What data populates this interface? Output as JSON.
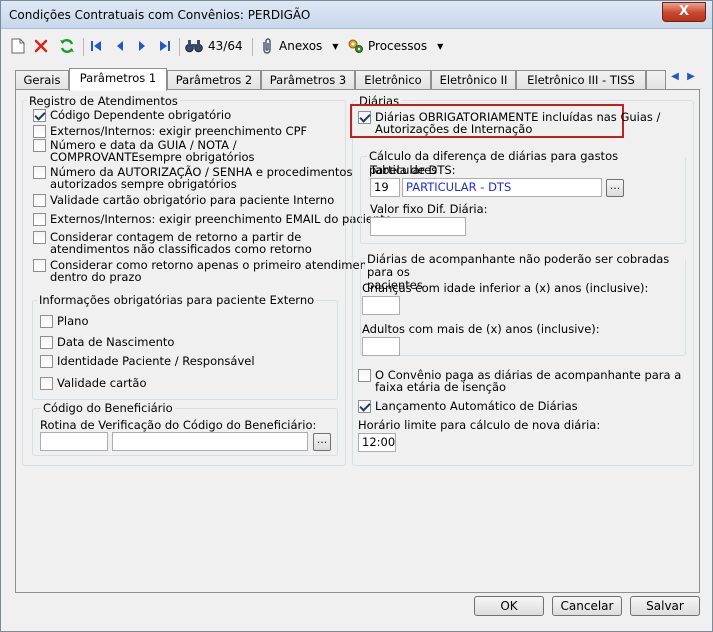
{
  "window": {
    "title": "Condições Contratuais com Convênios: PERDIGÃO",
    "close_label": "X"
  },
  "toolbar": {
    "record_counter": "43/64",
    "anexos_label": "Anexos",
    "processos_label": "Processos",
    "dropdown_glyph": "▼"
  },
  "tabs": [
    {
      "label": "Gerais"
    },
    {
      "label": "Parâmetros 1"
    },
    {
      "label": "Parâmetros 2"
    },
    {
      "label": "Parâmetros 3"
    },
    {
      "label": "Eletrônico"
    },
    {
      "label": "Eletrônico II"
    },
    {
      "label": "Eletrônico III - TISS"
    }
  ],
  "registro": {
    "title": "Registro de Atendimentos",
    "items": [
      {
        "label": "Código Dependente obrigatório",
        "checked": true
      },
      {
        "label": "Externos/Internos: exigir preenchimento CPF",
        "checked": false
      },
      {
        "label": "Número e data da GUIA / NOTA / COMPROVANTEsempre obrigatórios",
        "line1": "Número e data da GUIA / NOTA /",
        "line2": "COMPROVANTEsempre obrigatórios",
        "checked": false
      },
      {
        "label": "Número da AUTORIZAÇÃO / SENHA e procedimentos autorizados sempre obrigatórios",
        "line1": "Número da AUTORIZAÇÃO / SENHA e procedimentos",
        "line2": "autorizados sempre obrigatórios",
        "checked": false
      },
      {
        "label": "Validade cartão obrigatório para paciente Interno",
        "checked": false
      },
      {
        "label": "Externos/Internos: exigir preenchimento EMAIL do paciente",
        "checked": false
      },
      {
        "label": "Considerar contagem de retorno a partir de atendimentos não classificados como retorno",
        "line1": "Considerar contagem de retorno a partir de",
        "line2": "atendimentos não classificados como retorno",
        "checked": false
      },
      {
        "label": "Considerar como retorno apenas o primeiro atendimento dentro do prazo",
        "line1": "Considerar como retorno apenas o primeiro atendimento",
        "line2": "dentro do prazo",
        "checked": false
      }
    ]
  },
  "info_externo": {
    "title": "Informações obrigatórias para paciente Externo",
    "items": [
      {
        "label": "Plano",
        "checked": false
      },
      {
        "label": "Data de Nascimento",
        "checked": false
      },
      {
        "label": "Identidade Paciente / Responsável",
        "checked": false
      },
      {
        "label": "Validade cartão",
        "checked": false
      }
    ]
  },
  "beneficiario": {
    "title": "Código do Beneficiário",
    "rotina_label": "Rotina de Verificação do Código do Beneficiário:",
    "code_value": "",
    "name_value": "",
    "lookup_label": "..."
  },
  "diarias": {
    "title": "Diárias",
    "obrigatoria": {
      "line1": "Diárias OBRIGATORIAMENTE incluídas nas Guias /",
      "line2": "Autorizações de Internação",
      "checked": true
    },
    "calculo": {
      "title": "Cálculo da diferença de diárias para gastos particulares",
      "tabela_label": "Tabela de DTS:",
      "tabela_code": "19",
      "tabela_name": "PARTICULAR - DTS",
      "lookup_label": "...",
      "valor_label": "Valor fixo Dif. Diária:",
      "valor_value": ""
    },
    "acompanhante": {
      "title_line1": "Diárias de acompanhante não poderão ser cobradas para os",
      "title_line2": "pacientes",
      "criancas_label": "Crianças com idade inferior a (x) anos (inclusive):",
      "criancas_value": "",
      "adultos_label": "Adultos com mais de (x) anos (inclusive):",
      "adultos_value": ""
    },
    "convenio_paga": {
      "line1": "O Convênio paga as diárias de acompanhante para a",
      "line2": "faixa etária de isenção",
      "checked": false
    },
    "lancamento": {
      "label": "Lançamento Automático de Diárias",
      "checked": true
    },
    "horario_label": "Horário limite para cálculo de nova diária:",
    "horario_value": "12:00"
  },
  "footer": {
    "ok_label": "OK",
    "cancel_label": "Cancelar",
    "save_label": "Salvar"
  },
  "colors": {
    "accent_link": "#1f2fd0",
    "highlight": "#c0201e"
  }
}
